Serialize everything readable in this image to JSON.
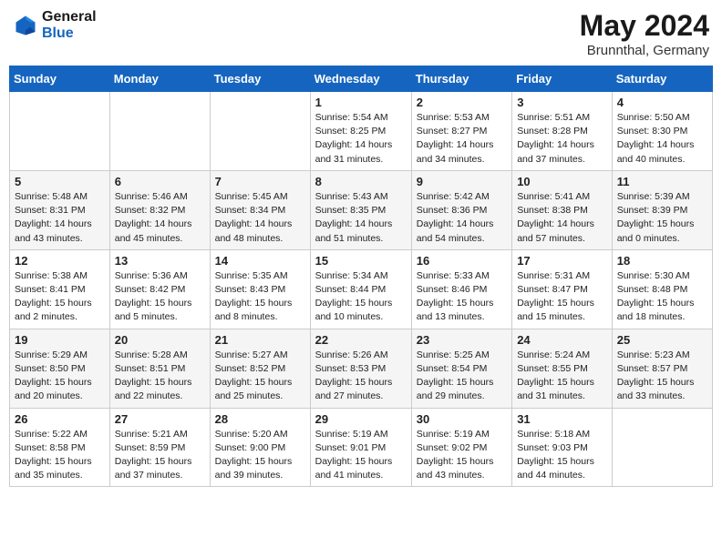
{
  "header": {
    "logo_general": "General",
    "logo_blue": "Blue",
    "month_year": "May 2024",
    "location": "Brunnthal, Germany"
  },
  "days_of_week": [
    "Sunday",
    "Monday",
    "Tuesday",
    "Wednesday",
    "Thursday",
    "Friday",
    "Saturday"
  ],
  "weeks": [
    [
      {
        "day": "",
        "info": ""
      },
      {
        "day": "",
        "info": ""
      },
      {
        "day": "",
        "info": ""
      },
      {
        "day": "1",
        "info": "Sunrise: 5:54 AM\nSunset: 8:25 PM\nDaylight: 14 hours\nand 31 minutes."
      },
      {
        "day": "2",
        "info": "Sunrise: 5:53 AM\nSunset: 8:27 PM\nDaylight: 14 hours\nand 34 minutes."
      },
      {
        "day": "3",
        "info": "Sunrise: 5:51 AM\nSunset: 8:28 PM\nDaylight: 14 hours\nand 37 minutes."
      },
      {
        "day": "4",
        "info": "Sunrise: 5:50 AM\nSunset: 8:30 PM\nDaylight: 14 hours\nand 40 minutes."
      }
    ],
    [
      {
        "day": "5",
        "info": "Sunrise: 5:48 AM\nSunset: 8:31 PM\nDaylight: 14 hours\nand 43 minutes."
      },
      {
        "day": "6",
        "info": "Sunrise: 5:46 AM\nSunset: 8:32 PM\nDaylight: 14 hours\nand 45 minutes."
      },
      {
        "day": "7",
        "info": "Sunrise: 5:45 AM\nSunset: 8:34 PM\nDaylight: 14 hours\nand 48 minutes."
      },
      {
        "day": "8",
        "info": "Sunrise: 5:43 AM\nSunset: 8:35 PM\nDaylight: 14 hours\nand 51 minutes."
      },
      {
        "day": "9",
        "info": "Sunrise: 5:42 AM\nSunset: 8:36 PM\nDaylight: 14 hours\nand 54 minutes."
      },
      {
        "day": "10",
        "info": "Sunrise: 5:41 AM\nSunset: 8:38 PM\nDaylight: 14 hours\nand 57 minutes."
      },
      {
        "day": "11",
        "info": "Sunrise: 5:39 AM\nSunset: 8:39 PM\nDaylight: 15 hours\nand 0 minutes."
      }
    ],
    [
      {
        "day": "12",
        "info": "Sunrise: 5:38 AM\nSunset: 8:41 PM\nDaylight: 15 hours\nand 2 minutes."
      },
      {
        "day": "13",
        "info": "Sunrise: 5:36 AM\nSunset: 8:42 PM\nDaylight: 15 hours\nand 5 minutes."
      },
      {
        "day": "14",
        "info": "Sunrise: 5:35 AM\nSunset: 8:43 PM\nDaylight: 15 hours\nand 8 minutes."
      },
      {
        "day": "15",
        "info": "Sunrise: 5:34 AM\nSunset: 8:44 PM\nDaylight: 15 hours\nand 10 minutes."
      },
      {
        "day": "16",
        "info": "Sunrise: 5:33 AM\nSunset: 8:46 PM\nDaylight: 15 hours\nand 13 minutes."
      },
      {
        "day": "17",
        "info": "Sunrise: 5:31 AM\nSunset: 8:47 PM\nDaylight: 15 hours\nand 15 minutes."
      },
      {
        "day": "18",
        "info": "Sunrise: 5:30 AM\nSunset: 8:48 PM\nDaylight: 15 hours\nand 18 minutes."
      }
    ],
    [
      {
        "day": "19",
        "info": "Sunrise: 5:29 AM\nSunset: 8:50 PM\nDaylight: 15 hours\nand 20 minutes."
      },
      {
        "day": "20",
        "info": "Sunrise: 5:28 AM\nSunset: 8:51 PM\nDaylight: 15 hours\nand 22 minutes."
      },
      {
        "day": "21",
        "info": "Sunrise: 5:27 AM\nSunset: 8:52 PM\nDaylight: 15 hours\nand 25 minutes."
      },
      {
        "day": "22",
        "info": "Sunrise: 5:26 AM\nSunset: 8:53 PM\nDaylight: 15 hours\nand 27 minutes."
      },
      {
        "day": "23",
        "info": "Sunrise: 5:25 AM\nSunset: 8:54 PM\nDaylight: 15 hours\nand 29 minutes."
      },
      {
        "day": "24",
        "info": "Sunrise: 5:24 AM\nSunset: 8:55 PM\nDaylight: 15 hours\nand 31 minutes."
      },
      {
        "day": "25",
        "info": "Sunrise: 5:23 AM\nSunset: 8:57 PM\nDaylight: 15 hours\nand 33 minutes."
      }
    ],
    [
      {
        "day": "26",
        "info": "Sunrise: 5:22 AM\nSunset: 8:58 PM\nDaylight: 15 hours\nand 35 minutes."
      },
      {
        "day": "27",
        "info": "Sunrise: 5:21 AM\nSunset: 8:59 PM\nDaylight: 15 hours\nand 37 minutes."
      },
      {
        "day": "28",
        "info": "Sunrise: 5:20 AM\nSunset: 9:00 PM\nDaylight: 15 hours\nand 39 minutes."
      },
      {
        "day": "29",
        "info": "Sunrise: 5:19 AM\nSunset: 9:01 PM\nDaylight: 15 hours\nand 41 minutes."
      },
      {
        "day": "30",
        "info": "Sunrise: 5:19 AM\nSunset: 9:02 PM\nDaylight: 15 hours\nand 43 minutes."
      },
      {
        "day": "31",
        "info": "Sunrise: 5:18 AM\nSunset: 9:03 PM\nDaylight: 15 hours\nand 44 minutes."
      },
      {
        "day": "",
        "info": ""
      }
    ]
  ]
}
